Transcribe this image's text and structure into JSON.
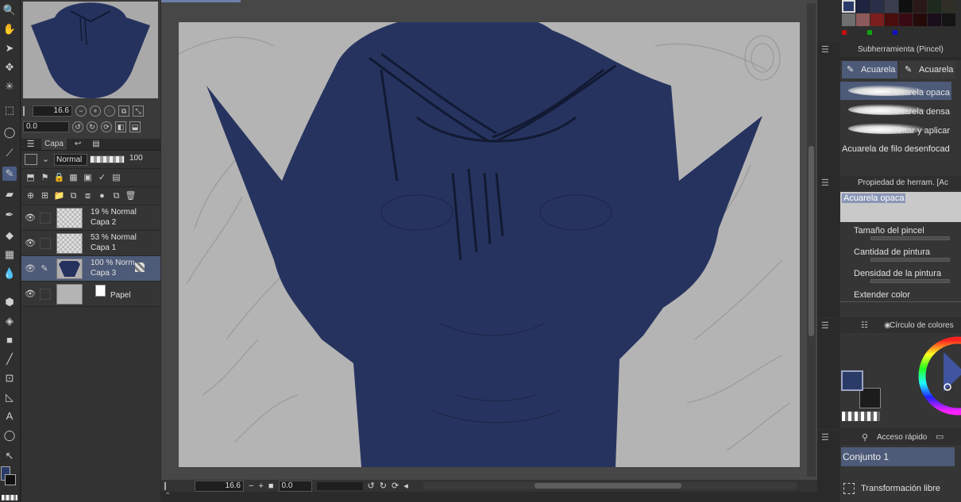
{
  "navigator": {
    "zoom": "16.6",
    "rotation": "0.0"
  },
  "layer_panel": {
    "tab_label": "Capa",
    "blend_mode": "Normal",
    "opacity": "100",
    "layers": [
      {
        "mode": "19 % Normal",
        "name": "Capa 2",
        "selected": false
      },
      {
        "mode": "53 % Normal",
        "name": "Capa 1",
        "selected": false
      },
      {
        "mode": "100 % Norm",
        "name": "Capa 3",
        "selected": true
      },
      {
        "mode": "",
        "name": "Papel",
        "selected": false
      }
    ]
  },
  "canvas_status": {
    "zoom": "16.6",
    "rotation": "0.0"
  },
  "palette": {
    "colors": [
      "#2b3b68",
      "#8a2a2a",
      "#1d2340",
      "#2a2f48",
      "#3a3e4e",
      "#101010",
      "#1c1c1c",
      "#2a1717",
      "#1e2a1e",
      "#2f2f28",
      "#343434",
      "#6f6f6f",
      "#8c5a5a",
      "#7a1e1e",
      "#4a0d0d",
      "#3a0a14",
      "#1e0a0a",
      "#250a0a",
      "#1a0e1a",
      "#120e1e",
      "#141414",
      "#111111"
    ],
    "accent_selected": "#2b3b68"
  },
  "subtool": {
    "title": "Subherramienta (Pincel)",
    "tabs": [
      "Acuarela",
      "Acuarela"
    ],
    "brushes": [
      "Acuarela opaca",
      "Acuarela densa",
      "Pintar y aplicar",
      "Acuarela de filo desenfocad"
    ]
  },
  "tool_property": {
    "title": "Propiedad de herram. [Ac",
    "current": "Acuarela opaca",
    "props": [
      "Tamaño del pincel",
      "Cantidad de pintura",
      "Densidad de la pintura",
      "Extender color"
    ]
  },
  "color_wheel": {
    "title": "Círculo de colores",
    "main_color": "#2b3b68",
    "sub_color": "#1c1c1c"
  },
  "quick_access": {
    "title": "Acceso rápido",
    "set": "Conjunto 1",
    "item": "Transformación libre"
  }
}
